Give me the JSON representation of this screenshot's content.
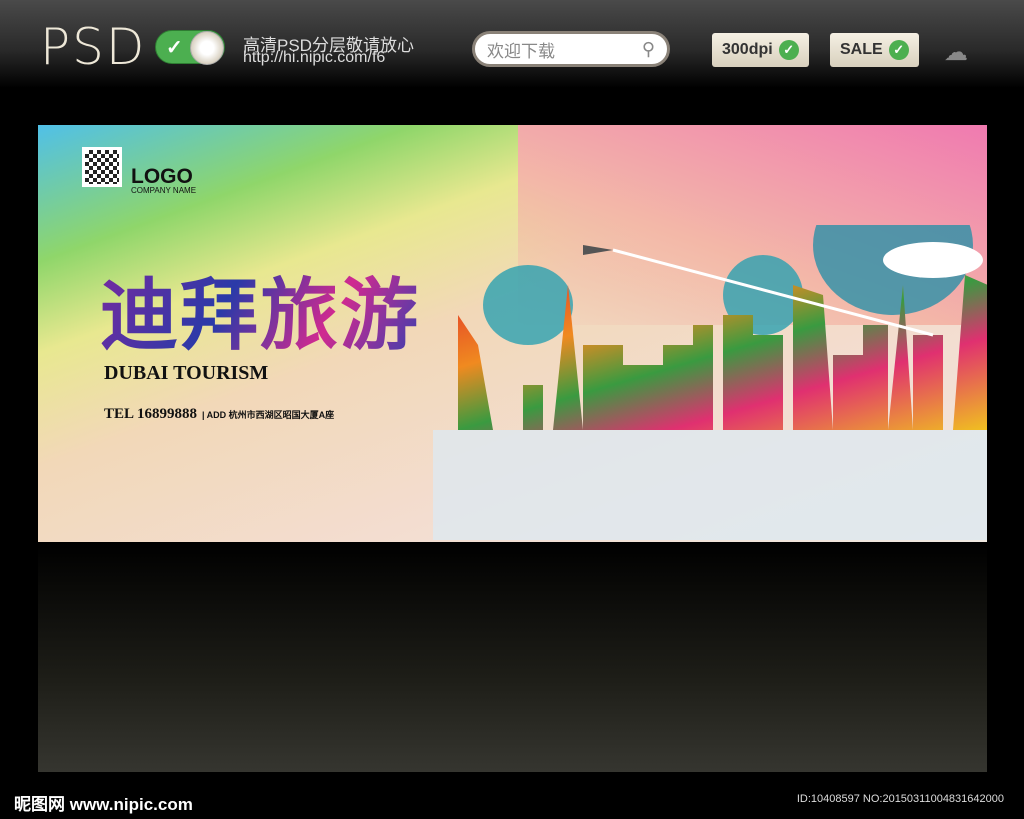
{
  "header": {
    "brand": "PSD",
    "toggle_check": "✓",
    "tagline": "高清PSD分层敬请放心",
    "url": "http://hi.nipic.com/f6",
    "search": {
      "placeholder": "欢迎下载",
      "icon": "search-icon"
    },
    "badges": [
      {
        "label": "300dpi",
        "icon": "check-icon"
      },
      {
        "label": "SALE",
        "icon": "check-icon"
      }
    ],
    "download_icon": "cloud-download-icon"
  },
  "poster": {
    "logo": "LOGO",
    "company": "COMPANY NAME",
    "title": "迪拜旅游",
    "subtitle": "DUBAI TOURISM",
    "tel_label": "TEL",
    "tel": "16899888",
    "address": "| ADD 杭州市西湖区昭国大厦A座"
  },
  "footer": {
    "site": "昵图网 www.nipic.com",
    "id": "ID:10408597 NO:20150311004831642000"
  }
}
